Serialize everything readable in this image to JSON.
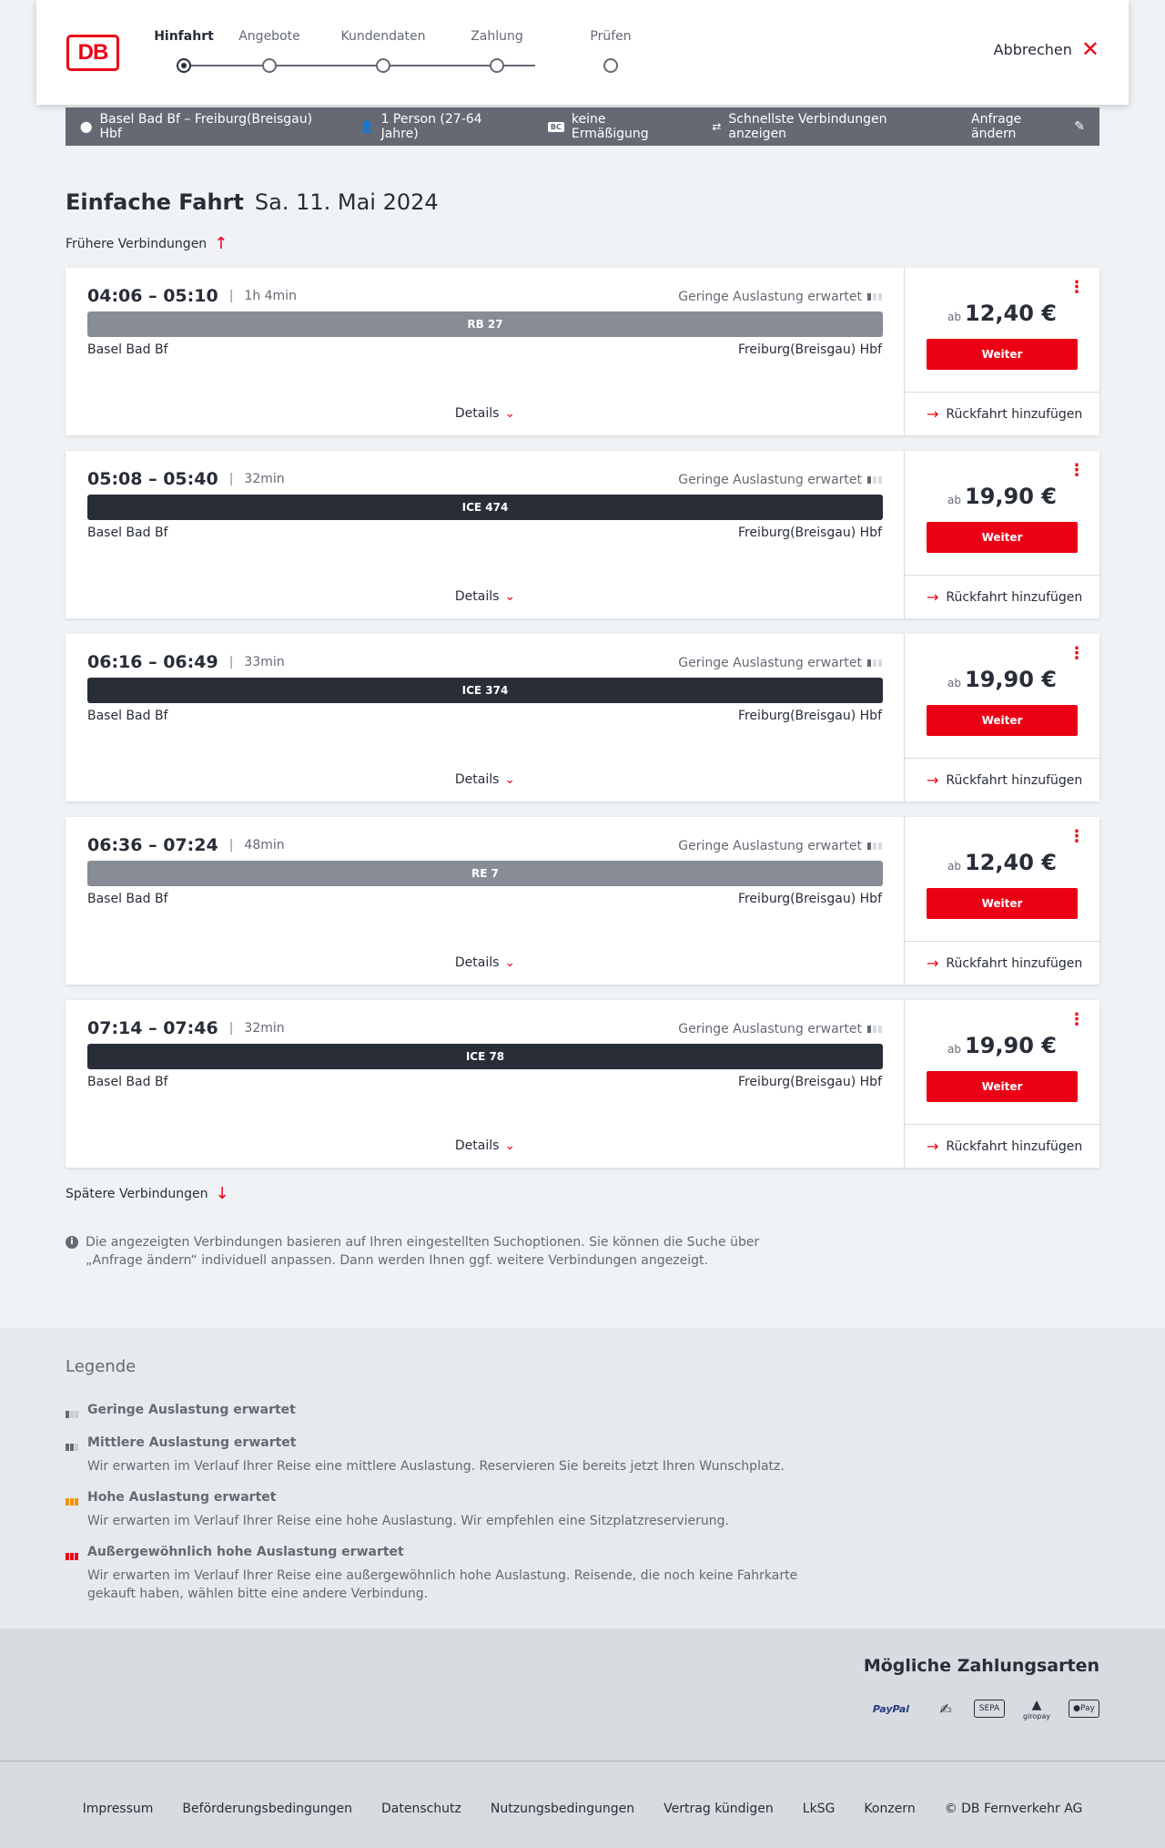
{
  "header": {
    "logo": "DB",
    "steps": [
      "Hinfahrt",
      "Angebote",
      "Kundendaten",
      "Zahlung",
      "Prüfen"
    ],
    "cancel_label": "Abbrechen"
  },
  "filterbar": {
    "route": "Basel Bad Bf – Freiburg(Breisgau) Hbf",
    "passengers": "1 Person (27-64 Jahre)",
    "discount_badge": "BC",
    "discount": "keine Ermäßigung",
    "fastest": "Schnellste Verbindungen anzeigen",
    "change": "Anfrage ändern"
  },
  "title": {
    "main": "Einfache Fahrt",
    "date": "Sa. 11. Mai 2024"
  },
  "earlier_label": "Frühere Verbindungen",
  "later_label": "Spätere Verbindungen",
  "connections": [
    {
      "times": "04:06 – 05:10",
      "duration": "1h 4min",
      "utilization": "Geringe Auslastung erwartet",
      "train": "RB 27",
      "train_type": "regional",
      "from": "Basel Bad Bf",
      "to": "Freiburg(Breisgau) Hbf",
      "details": "Details",
      "ab": "ab",
      "price": "12,40 €",
      "cta": "Weiter",
      "return": "Rückfahrt hinzufügen"
    },
    {
      "times": "05:08 – 05:40",
      "duration": "32min",
      "utilization": "Geringe Auslastung erwartet",
      "train": "ICE 474",
      "train_type": "ice",
      "from": "Basel Bad Bf",
      "to": "Freiburg(Breisgau) Hbf",
      "details": "Details",
      "ab": "ab",
      "price": "19,90 €",
      "cta": "Weiter",
      "return": "Rückfahrt hinzufügen"
    },
    {
      "times": "06:16 – 06:49",
      "duration": "33min",
      "utilization": "Geringe Auslastung erwartet",
      "train": "ICE 374",
      "train_type": "ice",
      "from": "Basel Bad Bf",
      "to": "Freiburg(Breisgau) Hbf",
      "details": "Details",
      "ab": "ab",
      "price": "19,90 €",
      "cta": "Weiter",
      "return": "Rückfahrt hinzufügen"
    },
    {
      "times": "06:36 – 07:24",
      "duration": "48min",
      "utilization": "Geringe Auslastung erwartet",
      "train": "RE 7",
      "train_type": "regional",
      "from": "Basel Bad Bf",
      "to": "Freiburg(Breisgau) Hbf",
      "details": "Details",
      "ab": "ab",
      "price": "12,40 €",
      "cta": "Weiter",
      "return": "Rückfahrt hinzufügen"
    },
    {
      "times": "07:14 – 07:46",
      "duration": "32min",
      "utilization": "Geringe Auslastung erwartet",
      "train": "ICE 78",
      "train_type": "ice",
      "from": "Basel Bad Bf",
      "to": "Freiburg(Breisgau) Hbf",
      "details": "Details",
      "ab": "ab",
      "price": "19,90 €",
      "cta": "Weiter",
      "return": "Rückfahrt hinzufügen"
    }
  ],
  "info": "Die angezeigten Verbindungen basieren auf Ihren eingestellten Suchoptionen. Sie können die Suche über „Anfrage ändern“ individuell anpassen. Dann werden Ihnen ggf. weitere Verbindungen angezeigt.",
  "legend": {
    "title": "Legende",
    "items": [
      {
        "label": "Geringe Auslastung erwartet",
        "desc": "",
        "color": "#646973"
      },
      {
        "label": "Mittlere Auslastung erwartet",
        "desc": "Wir erwarten im Verlauf Ihrer Reise eine mittlere Auslastung. Reservieren Sie bereits jetzt Ihren Wunschplatz.",
        "color": "#646973"
      },
      {
        "label": "Hohe Auslastung erwartet",
        "desc": "Wir erwarten im Verlauf Ihrer Reise eine hohe Auslastung. Wir empfehlen eine Sitzplatzreservierung.",
        "color": "#f39200"
      },
      {
        "label": "Außergewöhnlich hohe Auslastung erwartet",
        "desc": "Wir erwarten im Verlauf Ihrer Reise eine außergewöhnlich hohe Auslastung. Reisende, die noch keine Fahrkarte gekauft haben, wählen bitte eine andere Verbindung.",
        "color": "#ec0016"
      }
    ]
  },
  "payment": {
    "title": "Mögliche Zahlungsarten",
    "methods": [
      "PayPal",
      "SEPA",
      "giropay",
      "Pay"
    ]
  },
  "footer": {
    "links": [
      "Impressum",
      "Beförderungsbedingungen",
      "Datenschutz",
      "Nutzungsbedingungen",
      "Vertrag kündigen",
      "LkSG",
      "Konzern"
    ],
    "copyright": "© DB Fernverkehr AG"
  },
  "colors": {
    "accent": "#ec0016",
    "ice": "#282d37",
    "regional": "#878c96"
  }
}
